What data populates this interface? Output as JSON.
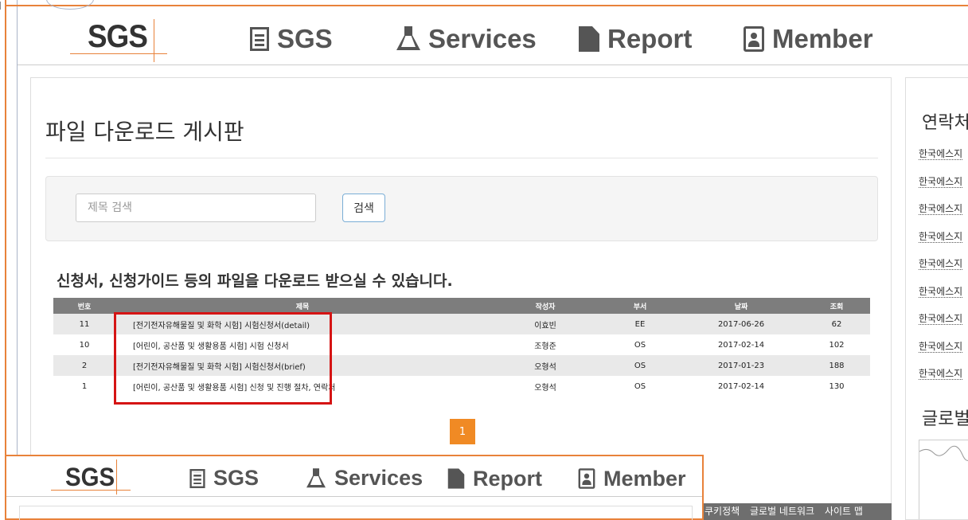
{
  "header": {
    "logo": "SGS",
    "nav": [
      {
        "label": "SGS",
        "icon": "building-icon"
      },
      {
        "label": "Services",
        "icon": "flask-icon"
      },
      {
        "label": "Report",
        "icon": "file-icon"
      },
      {
        "label": "Member",
        "icon": "member-icon"
      }
    ]
  },
  "main": {
    "title": "파일 다운로드 게시판",
    "search": {
      "placeholder": "제목 검색",
      "button": "검색"
    },
    "subtitle": "신청서, 신청가이드 등의 파일을 다운로드 받으실 수 있습니다.",
    "table": {
      "headers": [
        "번호",
        "제목",
        "작성자",
        "부서",
        "날짜",
        "조회"
      ],
      "rows": [
        [
          "11",
          "[전기전자유해물질 및 화학 시험] 시험신청서(detail)",
          "이효빈",
          "EE",
          "2017-06-26",
          "62"
        ],
        [
          "10",
          "[어린이, 공산품 및 생활용품 시험] 시험 신청서",
          "조형준",
          "OS",
          "2017-02-14",
          "102"
        ],
        [
          "2",
          "[전기전자유해물질 및 화학 시험] 시험신청서(brief)",
          "오형석",
          "OS",
          "2017-01-23",
          "188"
        ],
        [
          "1",
          "[어린이, 공산품 및 생활용품 시험] 신청 및 진행 절차, 연락처",
          "오형석",
          "OS",
          "2017-02-14",
          "130"
        ]
      ]
    },
    "pager": {
      "current": "1"
    }
  },
  "right": {
    "title": "연락처",
    "items": [
      "한국에스지",
      "한국에스지",
      "한국에스지",
      "한국에스지",
      "한국에스지",
      "한국에스지",
      "한국에스지",
      "한국에스지",
      "한국에스지"
    ],
    "section2": "글로벌"
  },
  "footer": {
    "links": [
      "쿠키정책",
      "글로벌 네트워크",
      "사이트 맵"
    ]
  },
  "overlay": {
    "logo": "SGS",
    "nav": [
      "SGS",
      "Services",
      "Report",
      "Member"
    ]
  },
  "colors": {
    "accent": "#f08a24",
    "highlight": "#d51414",
    "table_header": "#7d7d7d",
    "frame": "#e8823a"
  }
}
